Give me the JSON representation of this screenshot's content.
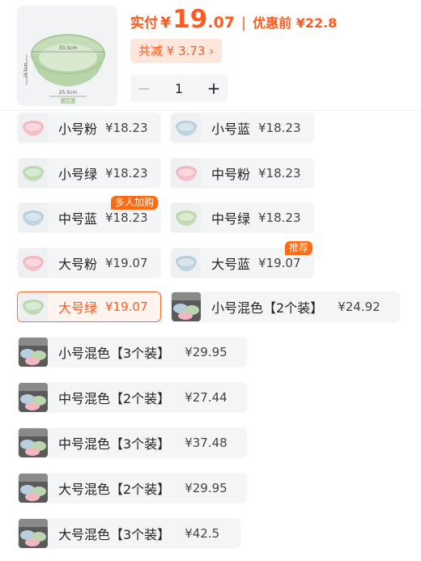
{
  "product": {
    "image_name": "basin-image",
    "image_dims": {
      "top": "33.5cm",
      "side": "14.5cm",
      "bottom": "25.5cm",
      "tag": "大号"
    }
  },
  "price": {
    "label": "实付",
    "currency": "¥",
    "integer": "19",
    "decimal": ".07",
    "separator": "|",
    "original": "优惠前 ¥22.8",
    "color": "#ff5a1f"
  },
  "discount": {
    "text": "共减 ¥ 3.73 ›"
  },
  "quantity": {
    "minus": "−",
    "value": "1",
    "plus": "+"
  },
  "options": [
    {
      "name": "小号粉",
      "price": "¥18.23",
      "color": "#f2b8c2",
      "icon": "basin-icon"
    },
    {
      "name": "小号蓝",
      "price": "¥18.23",
      "color": "#b7cfdd",
      "icon": "basin-icon"
    },
    {
      "name": "小号绿",
      "price": "¥18.23",
      "color": "#bad7ad",
      "icon": "basin-icon"
    },
    {
      "name": "中号粉",
      "price": "¥18.23",
      "color": "#f2b8c2",
      "icon": "basin-icon"
    },
    {
      "name": "中号蓝",
      "price": "¥18.23",
      "color": "#b7cfdd",
      "icon": "basin-icon",
      "badge": "多人加购"
    },
    {
      "name": "中号绿",
      "price": "¥18.23",
      "color": "#bad7ad",
      "icon": "basin-icon"
    },
    {
      "name": "大号粉",
      "price": "¥19.07",
      "color": "#f2b8c2",
      "icon": "basin-icon"
    },
    {
      "name": "大号蓝",
      "price": "¥19.07",
      "color": "#b7cfdd",
      "icon": "basin-icon",
      "badge": "推荐"
    },
    {
      "name": "大号绿",
      "price": "¥19.07",
      "color": "#bad7ad",
      "icon": "basin-icon",
      "selected": true
    },
    {
      "name": "小号混色【2个装】",
      "price": "¥24.92",
      "icon": "basin-set-icon"
    },
    {
      "name": "小号混色【3个装】",
      "price": "¥29.95",
      "icon": "basin-set-icon"
    },
    {
      "name": "中号混色【2个装】",
      "price": "¥27.44",
      "icon": "basin-set-icon"
    },
    {
      "name": "中号混色【3个装】",
      "price": "¥37.48",
      "icon": "basin-set-icon"
    },
    {
      "name": "大号混色【2个装】",
      "price": "¥29.95",
      "icon": "basin-set-icon"
    },
    {
      "name": "大号混色【3个装】",
      "price": "¥42.5",
      "icon": "basin-set-icon"
    }
  ],
  "colors": {
    "accent": "#ff5a1f",
    "badge": "#ff6a12",
    "selected_border": "#ff6a2b",
    "chip_bg": "#f4f5f7"
  }
}
